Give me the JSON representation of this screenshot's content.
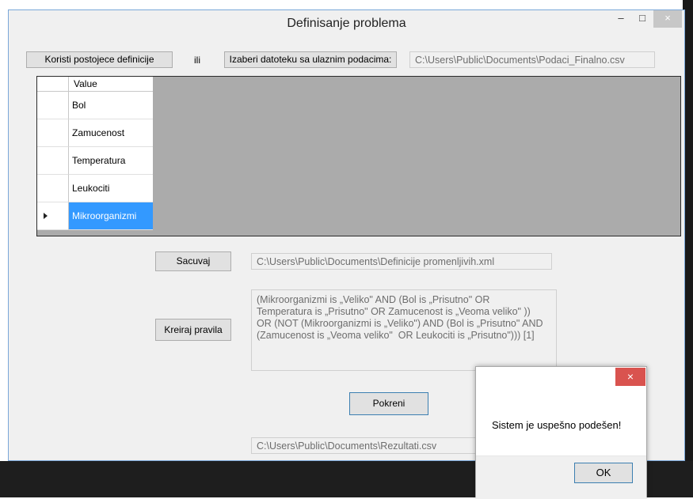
{
  "window": {
    "title": "Definisanje problema",
    "minimize_glyph": "–",
    "maximize_glyph": "□",
    "close_glyph": "×"
  },
  "top_row": {
    "use_existing_button": "Koristi postojece definicije",
    "or_label": "ili",
    "choose_file_button": "Izaberi datoteku sa ulaznim podacima:",
    "input_file_path": "C:\\Users\\Public\\Documents\\Podaci_Finalno.csv"
  },
  "grid": {
    "header": "Value",
    "rows": [
      "Bol",
      "Zamucenost",
      "Temperatura",
      "Leukociti",
      "Mikroorganizmi"
    ],
    "selected_index": 4
  },
  "save": {
    "button": "Sacuvaj",
    "path": "C:\\Users\\Public\\Documents\\Definicije promenljivih.xml"
  },
  "rules": {
    "button": "Kreiraj pravila",
    "text": "(Mikroorganizmi is „Veliko\" AND (Bol is „Prisutno\" OR\nTemperatura is „Prisutno\" OR Zamucenost is „Veoma veliko\" ))\nOR (NOT (Mikroorganizmi is „Veliko\") AND (Bol is „Prisutno\" AND\n(Zamucenost is „Veoma veliko\"  OR Leukociti is „Prisutno\"))) [1]"
  },
  "run": {
    "button": "Pokreni",
    "result_path": "C:\\Users\\Public\\Documents\\Rezultati.csv"
  },
  "dialog": {
    "message": "Sistem je uspešno podešen!",
    "ok_button": "OK",
    "close_glyph": "×"
  },
  "colors": {
    "selection": "#3399ff",
    "grid_background": "#ababab",
    "dialog_close": "#d9534f"
  }
}
